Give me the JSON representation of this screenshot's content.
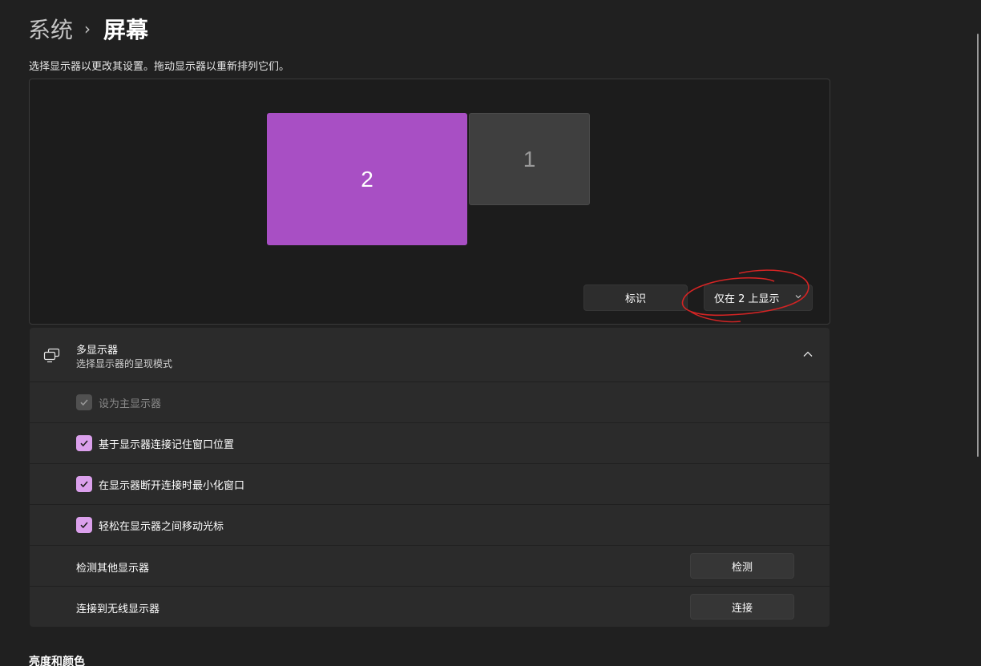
{
  "breadcrumb": {
    "parent": "系统",
    "separator": "›",
    "current": "屏幕"
  },
  "instructions": "选择显示器以更改其设置。拖动显示器以重新排列它们。",
  "monitors": [
    {
      "label": "2",
      "selected": true,
      "color": "#a84fc4"
    },
    {
      "label": "1",
      "selected": false,
      "color": "#3f3f3f"
    }
  ],
  "arrange_actions": {
    "identify_label": "标识",
    "display_mode_value": "仅在 2 上显示"
  },
  "annotation_color": "#d42424",
  "multi_display": {
    "title": "多显示器",
    "subtitle": "选择显示器的呈现模式",
    "expanded": true,
    "options": [
      {
        "label": "设为主显示器",
        "checked": true,
        "disabled": true
      },
      {
        "label": "基于显示器连接记住窗口位置",
        "checked": true,
        "disabled": false
      },
      {
        "label": "在显示器断开连接时最小化窗口",
        "checked": true,
        "disabled": false
      },
      {
        "label": "轻松在显示器之间移动光标",
        "checked": true,
        "disabled": false
      }
    ],
    "detect": {
      "label": "检测其他显示器",
      "button": "检测"
    },
    "wireless": {
      "label": "连接到无线显示器",
      "button": "连接"
    }
  },
  "next_section": "亮度和颜色",
  "accent_color": "#dba0ec"
}
